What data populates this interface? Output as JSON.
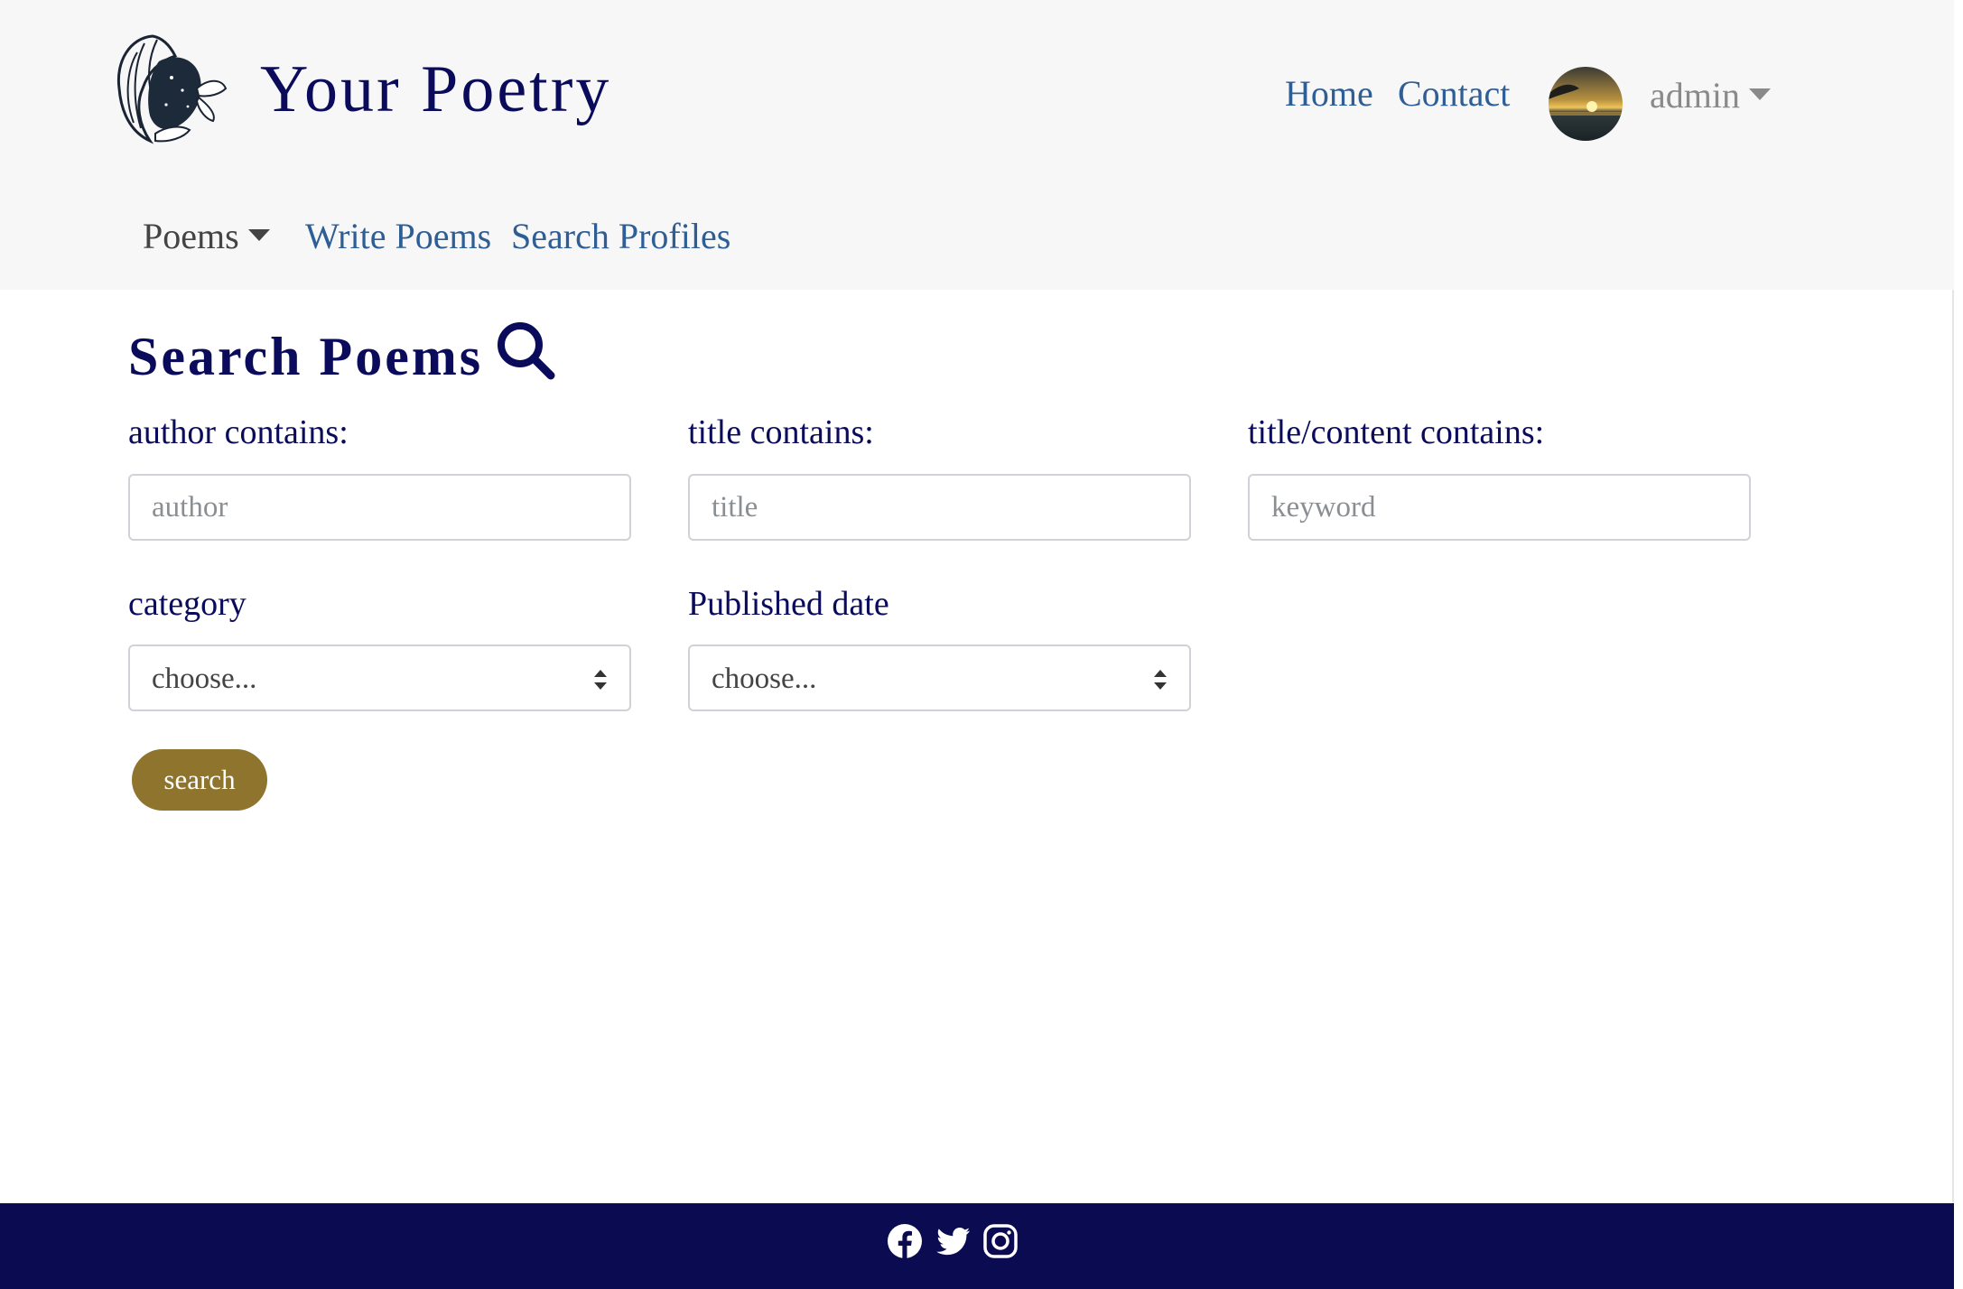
{
  "brand": {
    "title": "Your Poetry",
    "logo_icon": "woman-butterfly-logo"
  },
  "nav": {
    "home": "Home",
    "contact": "Contact",
    "user": "admin",
    "avatar_icon": "sunset-avatar"
  },
  "subnav": {
    "poems": "Poems",
    "write": "Write Poems",
    "search_profiles": "Search Profiles"
  },
  "page": {
    "heading": "Search Poems",
    "heading_icon": "search-icon"
  },
  "form": {
    "author": {
      "label": "author contains:",
      "placeholder": "author",
      "value": ""
    },
    "title": {
      "label": "title contains:",
      "placeholder": "title",
      "value": ""
    },
    "keyword": {
      "label": "title/content contains:",
      "placeholder": "keyword",
      "value": ""
    },
    "category": {
      "label": "category",
      "selected": "choose..."
    },
    "published": {
      "label": "Published date",
      "selected": "choose..."
    },
    "submit": "search"
  },
  "footer": {
    "icons": [
      "facebook-icon",
      "twitter-icon",
      "instagram-icon"
    ]
  },
  "colors": {
    "navy": "#0b0b5c",
    "link": "#2e5e96",
    "button": "#8e742c",
    "footer_bg": "#0b0b52",
    "navbar_bg": "#f7f7f7"
  }
}
